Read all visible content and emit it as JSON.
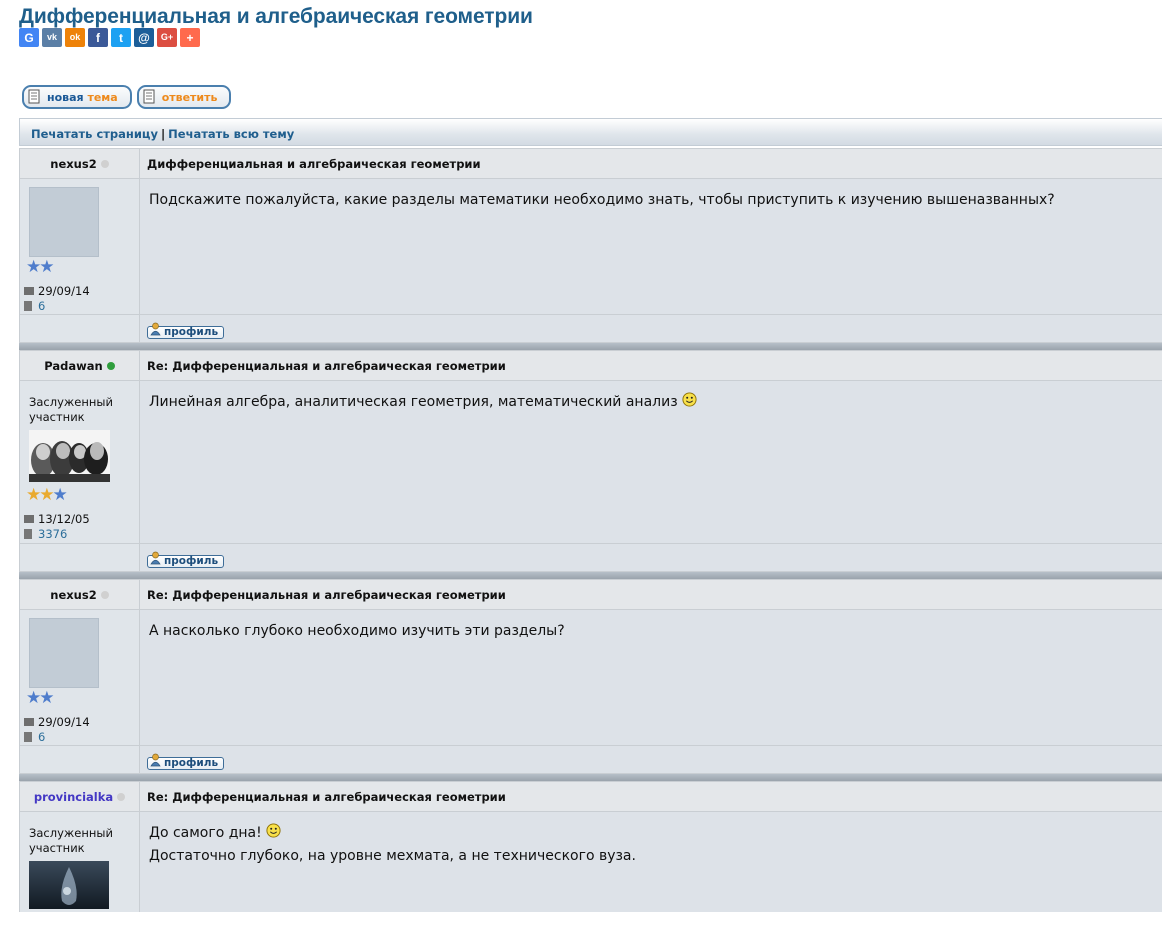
{
  "page": {
    "title": "Дифференциальная и алгебраическая геометрии"
  },
  "share": [
    {
      "name": "google-share-icon",
      "glyph": "G",
      "color": "#4285f4"
    },
    {
      "name": "vk-share-icon",
      "glyph": "vk",
      "color": "#5b7fa6"
    },
    {
      "name": "odnoklassniki-share-icon",
      "glyph": "ok",
      "color": "#ee8208"
    },
    {
      "name": "facebook-share-icon",
      "glyph": "f",
      "color": "#3b5998"
    },
    {
      "name": "twitter-share-icon",
      "glyph": "t",
      "color": "#1da1f2"
    },
    {
      "name": "mail-share-icon",
      "glyph": "@",
      "color": "#1c5e99"
    },
    {
      "name": "googleplus-share-icon",
      "glyph": "G+",
      "color": "#dc4e41"
    },
    {
      "name": "more-share-icon",
      "glyph": "+",
      "color": "#ff6a4d"
    }
  ],
  "actions": {
    "new_topic_w1": "новая",
    "new_topic_w2": "тема",
    "reply": "ответить"
  },
  "print_bar": {
    "print_page": "Печатать страницу",
    "separator": "|",
    "print_topic": "Печатать всю тему"
  },
  "profile_label": "профиль",
  "posts": [
    {
      "author": "nexus2",
      "online": false,
      "rank": "",
      "avatar": "empty",
      "stars": 2,
      "gold_stars": 0,
      "title": "Дифференциальная и алгебраическая геометрии",
      "body": [
        "Подскажите пожалуйста, какие разделы математики необходимо знать, чтобы приступить к изучению вышеназванных?"
      ],
      "joined": "29/09/14",
      "posts_count": "6"
    },
    {
      "author": "Padawan",
      "online": true,
      "rank": "Заслуженный участник",
      "avatar": "portrait",
      "stars": 3,
      "gold_stars": 2,
      "title": "Re: Дифференциальная и алгебраическая геометрии",
      "body": [
        "Линейная алгебра, аналитическая геометрия, математический анализ"
      ],
      "joined": "13/12/05",
      "posts_count": "3376"
    },
    {
      "author": "nexus2",
      "online": false,
      "rank": "",
      "avatar": "empty",
      "stars": 2,
      "gold_stars": 0,
      "title": "Re: Дифференциальная и алгебраическая геометрии",
      "body": [
        "А насколько глубоко необходимо изучить эти разделы?"
      ],
      "joined": "29/09/14",
      "posts_count": "6"
    },
    {
      "author": "provincialka",
      "online": false,
      "rank": "Заслуженный участник",
      "avatar": "drop",
      "title": "Re: Дифференциальная и алгебраическая геометрии",
      "body": [
        "До самого дна!",
        "Достаточно глубоко, на уровне мехмата, а не технического вуза."
      ]
    }
  ]
}
